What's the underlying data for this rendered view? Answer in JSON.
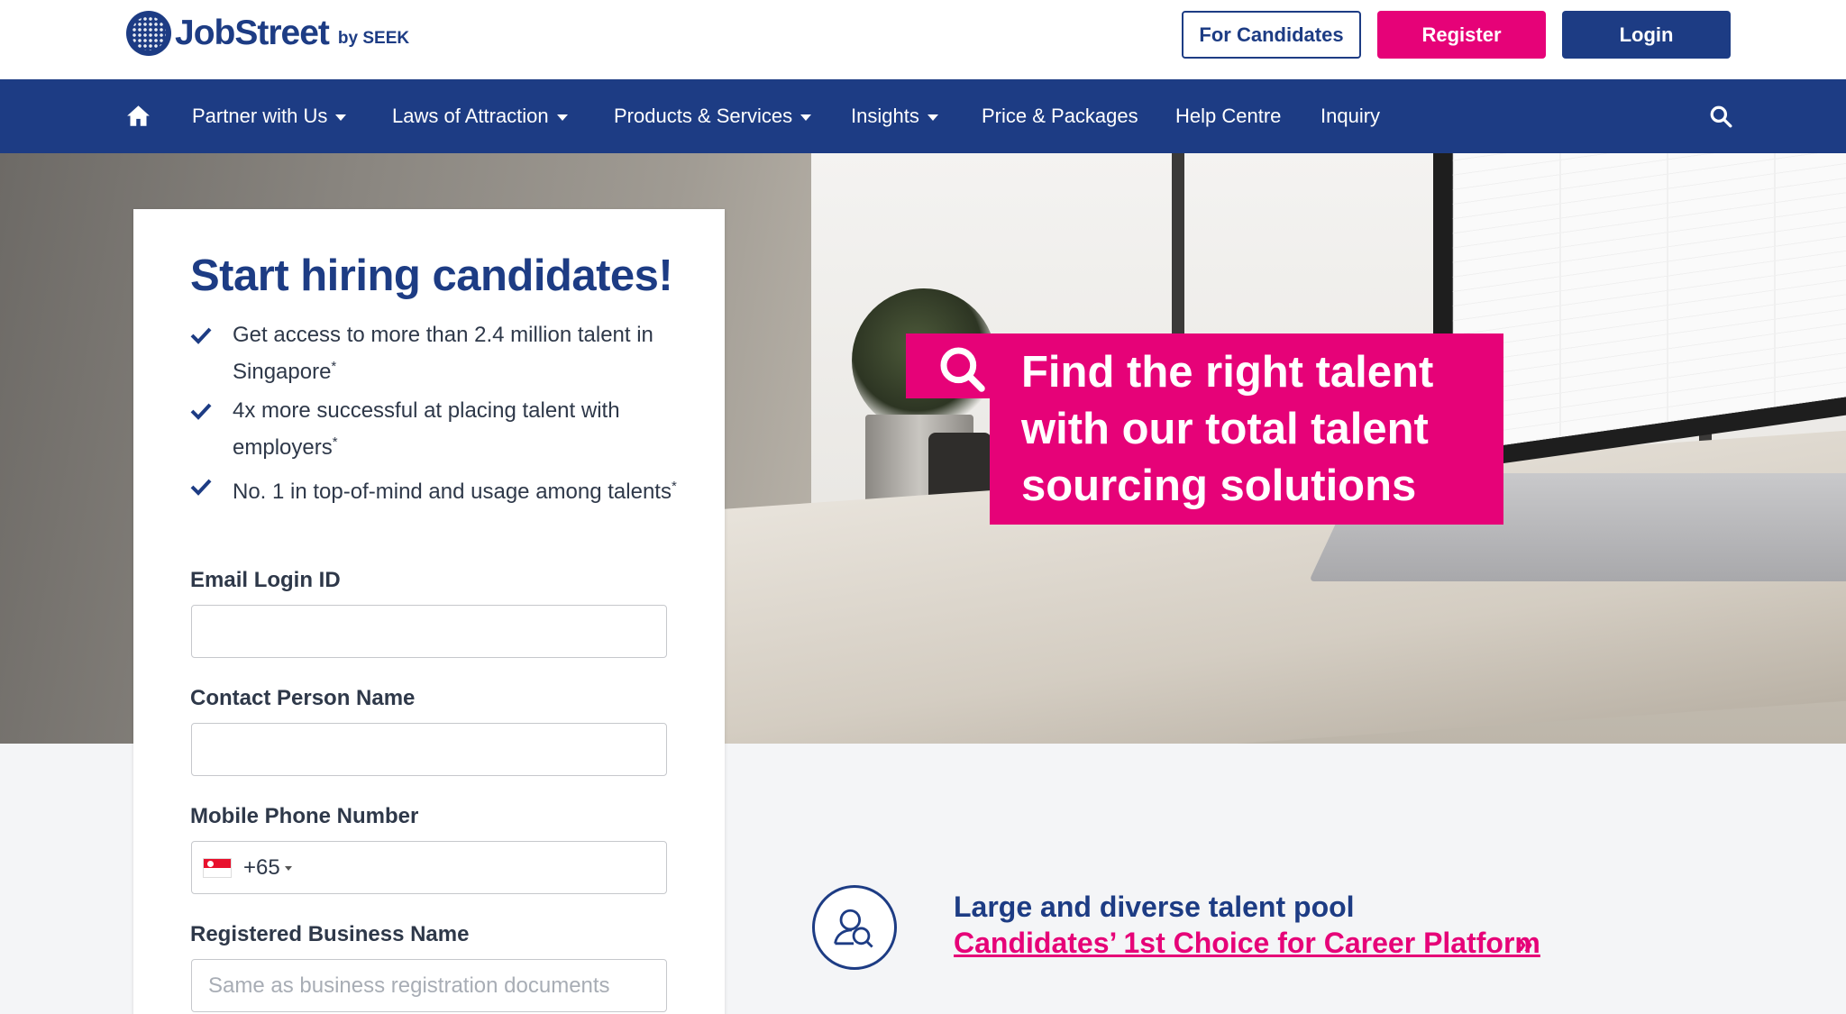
{
  "header": {
    "logo_text": "JobStreet",
    "logo_by": "by SEEK",
    "for_candidates_label": "For Candidates",
    "register_label": "Register",
    "login_label": "Login"
  },
  "nav": {
    "items": [
      {
        "label": "Partner with Us",
        "dropdown": true
      },
      {
        "label": "Laws of Attraction",
        "dropdown": true
      },
      {
        "label": "Products & Services",
        "dropdown": true
      },
      {
        "label": "Insights",
        "dropdown": true
      },
      {
        "label": "Price & Packages",
        "dropdown": false
      },
      {
        "label": "Help Centre",
        "dropdown": false
      },
      {
        "label": "Inquiry",
        "dropdown": false
      }
    ],
    "home_icon": "home-icon",
    "search_icon": "search-icon"
  },
  "hero": {
    "promo_lines": [
      "Find the right talent",
      "with our total talent",
      "sourcing solutions"
    ]
  },
  "form": {
    "title": "Start hiring candidates!",
    "features": [
      {
        "text": "Get access to more than 2.4 million talent in Singapore",
        "mark": "*"
      },
      {
        "text": "4x more successful at placing talent with employers",
        "mark": "*"
      },
      {
        "text": "No. 1 in top-of-mind and usage among talents",
        "mark": "*"
      }
    ],
    "email_label": "Email Login ID",
    "email_value": "",
    "contact_label": "Contact Person Name",
    "contact_value": "",
    "mobile_label": "Mobile Phone Number",
    "dial_code": "+65",
    "business_label": "Registered Business Name",
    "business_placeholder": "Same as business registration documents"
  },
  "benefit": {
    "title": "Large and diverse talent pool",
    "link": "Candidates’ 1st Choice for Career Platform",
    "arrow": "»"
  },
  "colors": {
    "brand_blue": "#1d3c84",
    "brand_pink": "#e60278"
  }
}
